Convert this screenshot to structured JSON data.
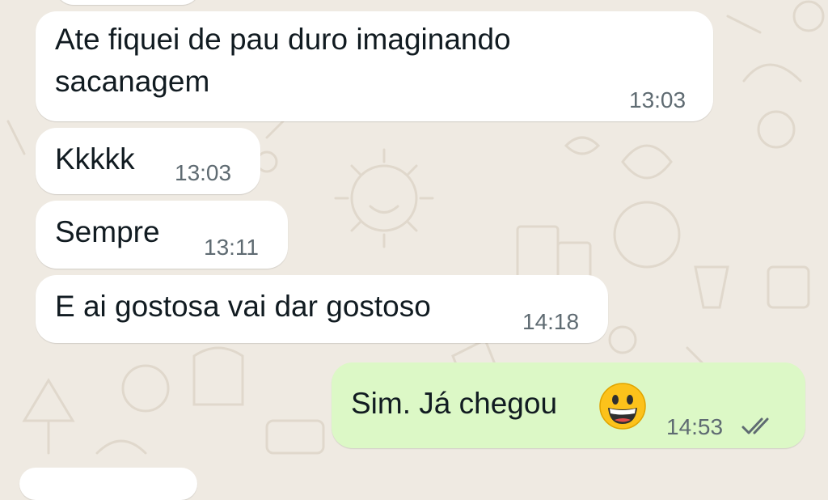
{
  "theme": {
    "chat_background": "#efeae2",
    "incoming_bubble": "#ffffff",
    "outgoing_bubble": "#dcf8c6",
    "read_ticks_color": "#8696a0"
  },
  "messages": [
    {
      "direction": "incoming",
      "lines": [
        "Ate fiquei de pau duro imaginando",
        "sacanagem"
      ],
      "time": "13:03"
    },
    {
      "direction": "incoming",
      "lines": [
        "Kkkkk"
      ],
      "time": "13:03"
    },
    {
      "direction": "incoming",
      "lines": [
        "Sempre"
      ],
      "time": "13:11"
    },
    {
      "direction": "incoming",
      "lines": [
        "E ai gostosa vai dar gostoso"
      ],
      "time": "14:18"
    },
    {
      "direction": "outgoing",
      "lines": [
        "Sim. Já chegou"
      ],
      "emoji": "grinning-face-icon",
      "time": "14:53",
      "status": "read-double-check-icon"
    }
  ]
}
